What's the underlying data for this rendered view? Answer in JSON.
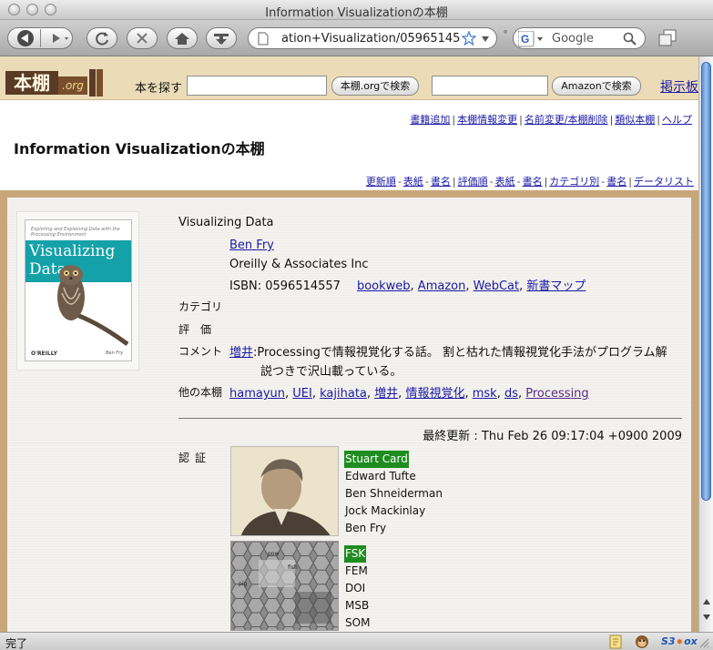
{
  "window": {
    "title": "Information Visualizationの本棚"
  },
  "toolbar": {
    "url": "ation+Visualization/0596514557",
    "search_placeholder": "Google",
    "back_icon": "back-arrow-icon",
    "forward_icon": "forward-arrow-icon"
  },
  "header": {
    "logo": "本棚",
    "logo_suffix": ".org",
    "search_label": "本を探す",
    "honbana_search_button": "本棚.orgで検索",
    "amazon_search_button": "Amazonで検索",
    "bbs_link": "掲示板"
  },
  "top_links": [
    "書籍追加",
    "本棚情報変更",
    "名前変更/本棚削除",
    "類似本棚",
    "ヘルプ"
  ],
  "page_title": "Information Visualizationの本棚",
  "sort_links": [
    "更新順",
    "表紙",
    "書名",
    "評価順",
    "表紙",
    "書名",
    "カテゴリ別",
    "書名",
    "データリスト"
  ],
  "book": {
    "cover": {
      "subtitle": "Exploring and Explaining Data with the Processing Environment",
      "title_line1": "Visualizing",
      "title_line2": "Data",
      "publisher": "O'REILLY",
      "author": "Ben Fry"
    },
    "title": "Visualizing Data",
    "author": "Ben Fry",
    "publisher": "Oreilly & Associates Inc",
    "isbn_label": "ISBN: 0596514557",
    "isbn_links": [
      "bookweb",
      "Amazon",
      "WebCat",
      "新書マップ"
    ],
    "category_label": "カテゴリ",
    "rating_label": "評　価",
    "comment_label": "コメント",
    "comment_author": "増井",
    "comment_line1": "Processingで情報視覚化する話。 割と枯れた情報視覚化手法がプログラム解",
    "comment_line2": "説つきで沢山載っている。",
    "other_label": "他の本棚",
    "other_shelves": [
      "hamayun",
      "UEI",
      "kajihata",
      "増井",
      "情報視覚化",
      "msk",
      "ds",
      "Processing"
    ],
    "updated": "最終更新 : Thu Feb 26 09:17:04 +0900 2009",
    "auth_label": "認証",
    "auth_group1": [
      "Stuart Card",
      "Edward Tufte",
      "Ben Shneiderman",
      "Jock Mackinlay",
      "Ben Fry"
    ],
    "auth_group2": [
      "FSK",
      "FEM",
      "DOI",
      "MSB",
      "SOM"
    ],
    "hex_labels": [
      "pow",
      "fish",
      "pig"
    ]
  },
  "status": {
    "text": "完了",
    "s3": "S3",
    "fox": "ox"
  }
}
